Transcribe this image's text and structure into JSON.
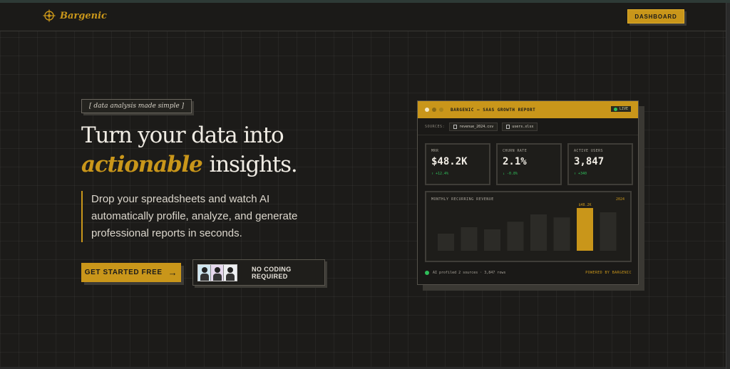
{
  "nav": {
    "brand": "Bargenic",
    "dashboard_label": "DASHBOARD"
  },
  "hero": {
    "tag": "[ data analysis made simple ]",
    "headline_line1": "Turn your data into",
    "headline_accent": "actionable",
    "headline_rest": "insights.",
    "description": "Drop your spreadsheets and watch AI automatically profile, analyze, and generate professional reports in seconds.",
    "cta_label": "GET STARTED FREE",
    "cta_arrow": "→",
    "no_coding": "NO CODING REQUIRED"
  },
  "report": {
    "title": "BARGENIC — SAAS GROWTH REPORT",
    "live": "LIVE",
    "sources_label": "SOURCES:",
    "files": [
      "revenue_2024.csv",
      "users.xlsx"
    ],
    "metrics": [
      {
        "label": "MRR",
        "value": "$48.2K",
        "delta": "↑ +12.4%"
      },
      {
        "label": "CHURN RATE",
        "value": "2.1%",
        "delta": "↓ -0.8%"
      },
      {
        "label": "ACTIVE USERS",
        "value": "3,847",
        "delta": "↑ +340"
      }
    ],
    "chart_title": "MONTHLY RECURRING REVENUE",
    "chart_year": "2024",
    "footer_text": "AI profiled 2 sources · 3,847 rows",
    "powered_by": "POWERED BY BARGENIC"
  },
  "chart_data": {
    "type": "bar",
    "title": "MONTHLY RECURRING REVENUE",
    "categories": [
      "",
      "",
      "",
      "",
      "",
      "",
      "",
      ""
    ],
    "values": [
      0.4,
      0.55,
      0.5,
      0.68,
      0.85,
      0.78,
      1.0,
      0.9
    ],
    "highlight_index": 6,
    "highlight_label": "$48.2K",
    "ylim": [
      0,
      1
    ]
  },
  "colors": {
    "accent": "#c9961a",
    "background": "#1c1b19",
    "positive": "#2fbf5a"
  }
}
